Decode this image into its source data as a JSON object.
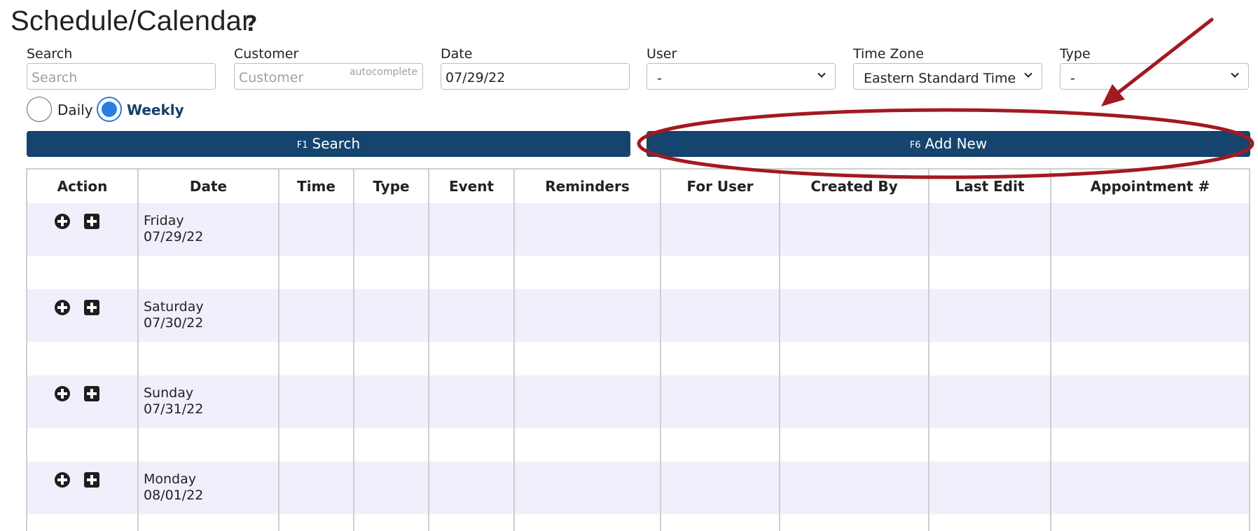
{
  "page": {
    "title": "Schedule/Calendar",
    "help_icon": "?"
  },
  "filters": {
    "search": {
      "label": "Search",
      "placeholder": "Search",
      "value": ""
    },
    "customer": {
      "label": "Customer",
      "placeholder": "Customer",
      "hint": "autocomplete",
      "value": ""
    },
    "date": {
      "label": "Date",
      "value": "07/29/22"
    },
    "user": {
      "label": "User",
      "selected": "-"
    },
    "time_zone": {
      "label": "Time Zone",
      "selected": "Eastern Standard Time"
    },
    "type": {
      "label": "Type",
      "selected": "-"
    }
  },
  "view_mode": {
    "daily_label": "Daily",
    "weekly_label": "Weekly",
    "selected": "Weekly"
  },
  "buttons": {
    "search": {
      "fkey": "F1",
      "label": "Search"
    },
    "add_new": {
      "fkey": "F6",
      "label": "Add New"
    }
  },
  "table": {
    "columns": [
      "Action",
      "Date",
      "Time",
      "Type",
      "Event",
      "Reminders",
      "For User",
      "Created By",
      "Last Edit",
      "Appointment #"
    ],
    "days": [
      {
        "weekday": "Friday",
        "date": "07/29/22"
      },
      {
        "weekday": "Saturday",
        "date": "07/30/22"
      },
      {
        "weekday": "Sunday",
        "date": "07/31/22"
      },
      {
        "weekday": "Monday",
        "date": "08/01/22"
      }
    ]
  },
  "icons": {
    "add_circle": "plus-circle-icon",
    "add_square": "plus-square-icon",
    "chevron": "chevron-down-icon"
  },
  "colors": {
    "primary_button": "#15446e",
    "radio_selected": "#2a7de1",
    "row_shade": "#eff0fb",
    "annotation": "#a3191f"
  }
}
